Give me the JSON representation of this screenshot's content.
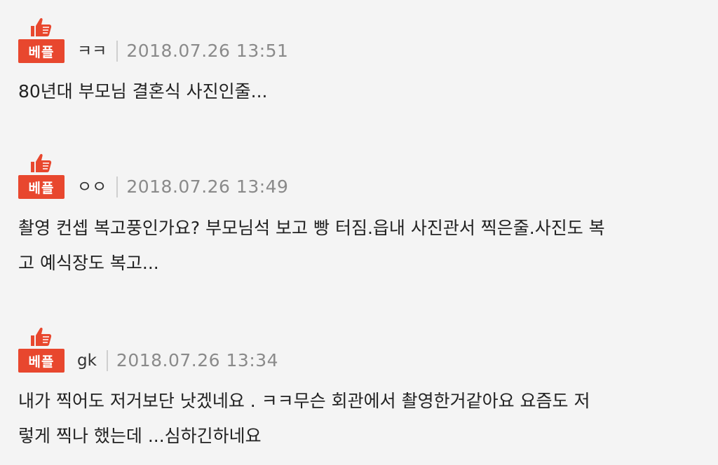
{
  "badge_label": "베플",
  "accent_color": "#e8472e",
  "comments": [
    {
      "author": "ㅋㅋ",
      "timestamp": "2018.07.26 13:51",
      "lines": [
        "80년대 부모님 결혼식 사진인줄..."
      ]
    },
    {
      "author": "ㅇㅇ",
      "timestamp": "2018.07.26 13:49",
      "lines": [
        "촬영 컨셉 복고풍인가요? 부모님석 보고 빵 터짐.읍내 사진관서 찍은줄.사진도 복",
        "고 예식장도 복고..."
      ]
    },
    {
      "author": "gk",
      "timestamp": "2018.07.26 13:34",
      "lines": [
        "내가 찍어도 저거보단 낫겠네요 . ㅋㅋ무슨 회관에서 촬영한거같아요 요즘도 저",
        "렇게 찍나 했는데 ...심하긴하네요"
      ]
    }
  ]
}
